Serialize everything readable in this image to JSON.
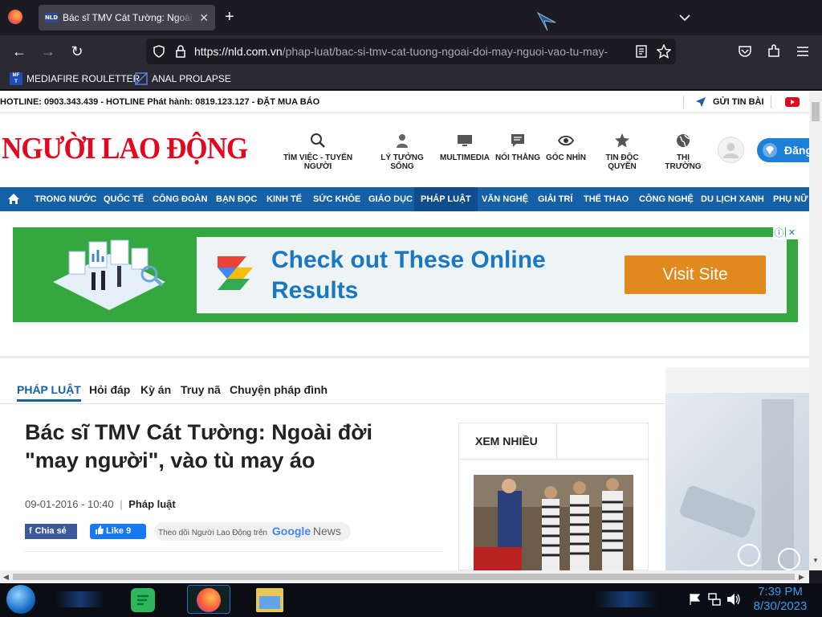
{
  "browser": {
    "tab_title": "Bác sĩ TMV Cát Tường: Ngoài đời \"may",
    "tab_favicon": "NLD",
    "url_main": "https://nld.com.vn",
    "url_path": "/phap-luat/bac-si-tmv-cat-tuong-ngoai-doi-may-nguoi-vao-tu-may-",
    "bookmarks": [
      {
        "label": "MEDIAFIRE ROULETTER",
        "icon": "mediafire-icon"
      },
      {
        "label": "ANAL PROLAPSE",
        "icon": "bookmark-triangle-icon"
      }
    ]
  },
  "site": {
    "hotline": "HOTLINE: 0903.343.439 - HOTLINE Phát hành: 0819.123.127 - ĐẶT MUA BÁO",
    "send_tip": "GỬI TIN BÀI",
    "logo": "NGƯỜI LAO ĐỘNG",
    "login": "Đăng",
    "topics": [
      {
        "label": "TÌM VIỆC - TUYỂN NGƯỜI",
        "icon": "search-icon"
      },
      {
        "label": "LÝ TƯỞNG SỐNG",
        "icon": "person-icon"
      },
      {
        "label": "MULTIMEDIA",
        "icon": "monitor-icon"
      },
      {
        "label": "NÓI THẲNG",
        "icon": "comment-icon"
      },
      {
        "label": "GÓC NHÌN",
        "icon": "eye-icon"
      },
      {
        "label": "TIN ĐỘC QUYỀN",
        "icon": "star-icon"
      },
      {
        "label": "THỊ TRƯỜNG",
        "icon": "globe-icon"
      }
    ],
    "nav": [
      "TRONG NƯỚC",
      "QUỐC TẾ",
      "CÔNG ĐOÀN",
      "BẠN ĐỌC",
      "KINH TẾ",
      "SỨC KHỎE",
      "GIÁO DỤC",
      "PHÁP LUẬT",
      "VĂN NGHỆ",
      "GIẢI TRÍ",
      "THỂ THAO",
      "CÔNG NGHỆ",
      "DU LỊCH XANH",
      "PHỤ NỮ"
    ],
    "nav_active": "PHÁP LUẬT"
  },
  "ad": {
    "headline": "Check out These Online Results",
    "button": "Visit Site",
    "close": "✕",
    "info": "ⓘ"
  },
  "article": {
    "subnav": [
      "PHÁP LUẬT",
      "Hỏi đáp",
      "Kỳ án",
      "Truy nã",
      "Chuyện pháp đình"
    ],
    "title": "Bác sĩ TMV Cát Tường: Ngoài đời \"may người\", vào tù may áo",
    "date": "09-01-2016 - 10:40",
    "category": "Pháp luật",
    "share": "Chia sẻ",
    "like": "Like 9",
    "follow": "Theo dõi Người Lao Động trên",
    "google": "Google",
    "news": "News",
    "most_viewed": "XEM NHIỀU"
  },
  "taskbar": {
    "time": "7:39 PM",
    "date": "8/30/2023"
  },
  "colors": {
    "brand_red": "#e4051e",
    "nav_blue": "#1660a8",
    "ad_green": "#35a73f"
  }
}
